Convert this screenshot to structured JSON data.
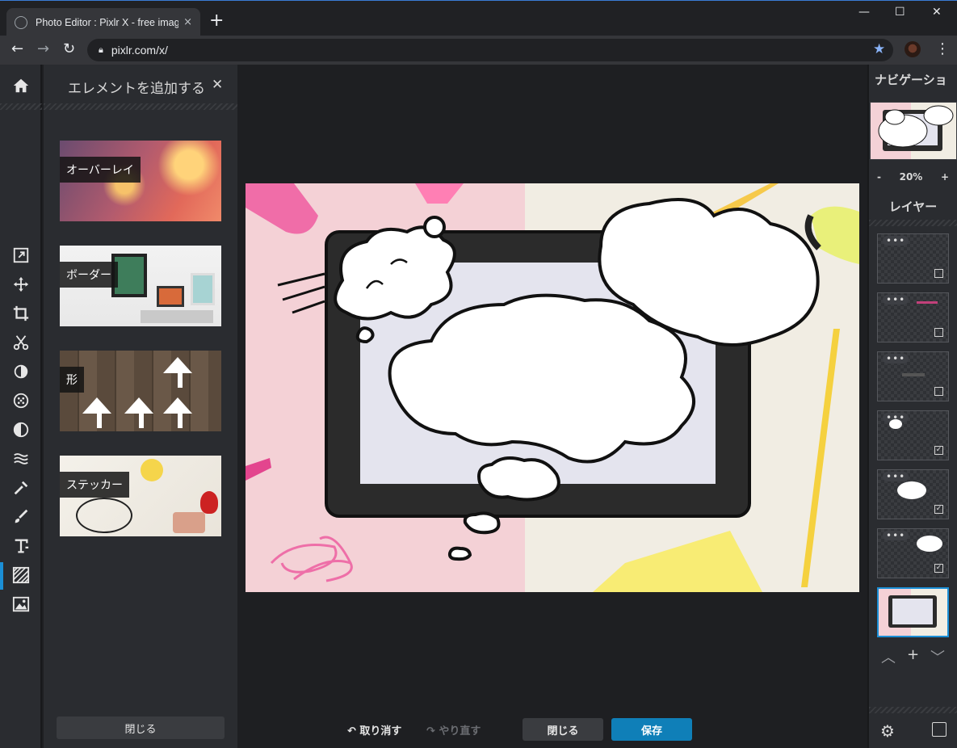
{
  "browser": {
    "tab_title": "Photo Editor : Pixlr X - free image",
    "tab_close": "×",
    "new_tab": "+",
    "url": "pixlr.com/x/",
    "window_controls": {
      "minimize": "—",
      "maximize": "☐",
      "close": "✕"
    },
    "nav": {
      "back": "←",
      "forward": "→",
      "reload": "↻"
    }
  },
  "left_panel": {
    "title": "エレメントを追加する",
    "close": "✕",
    "categories": [
      {
        "label": "オーバーレイ"
      },
      {
        "label": "ボーダー"
      },
      {
        "label": "形"
      },
      {
        "label": "ステッカー"
      }
    ],
    "close_button": "閉じる"
  },
  "bottom_bar": {
    "undo": "取り消す",
    "redo": "やり直す",
    "close": "閉じる",
    "save": "保存"
  },
  "right_panel": {
    "navigation_title": "ナビゲーショ",
    "zoom_minus": "-",
    "zoom_level": "20%",
    "zoom_plus": "+",
    "layers_title": "レイヤー",
    "layers": [
      {
        "dots": "•••",
        "checked": false
      },
      {
        "dots": "•••",
        "checked": false
      },
      {
        "dots": "•••",
        "checked": false
      },
      {
        "dots": "•••",
        "checked": true
      },
      {
        "dots": "•••",
        "checked": true
      },
      {
        "dots": "•••",
        "checked": true
      },
      {
        "dots": "",
        "checked": true
      }
    ],
    "layer_actions": {
      "up": "︿",
      "add": "+",
      "down": "﹀"
    }
  },
  "colors": {
    "accent": "#0f7fb8",
    "active_tool": "#1b8fd6",
    "panel_bg": "#2a2c30",
    "canvas_bg": "#1e1f22"
  }
}
